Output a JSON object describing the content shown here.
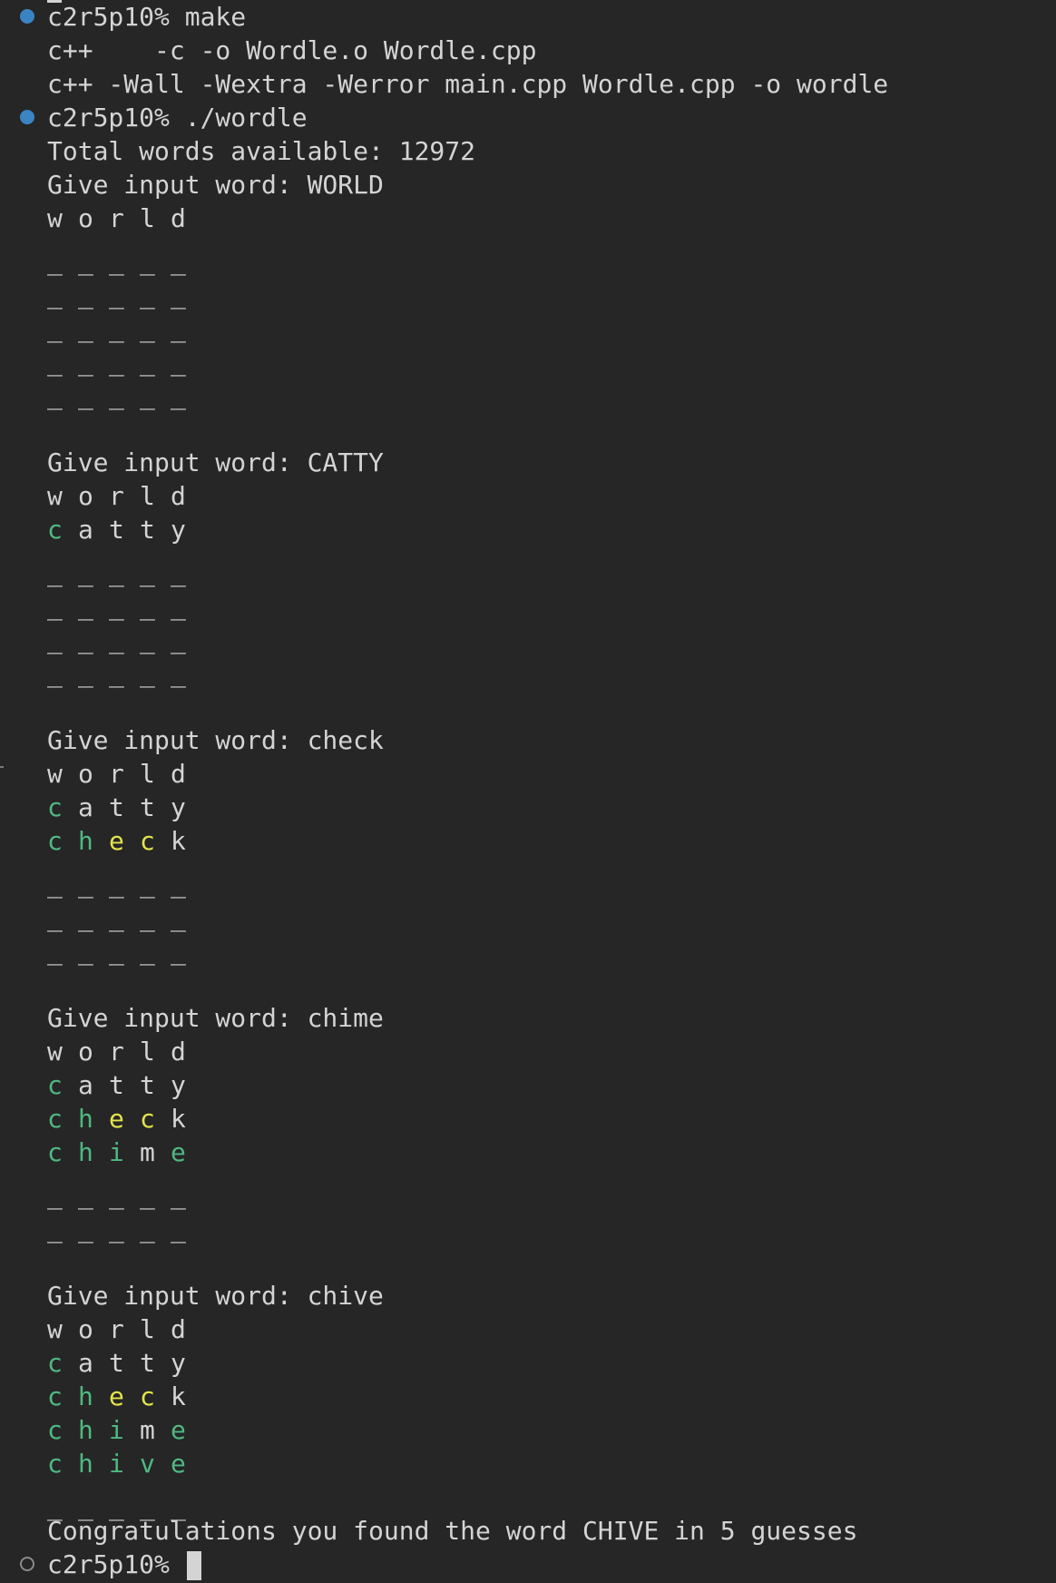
{
  "prompt": "c2r5p10%",
  "commands": {
    "make": "make",
    "run": "./wordle"
  },
  "build_output": [
    "c++    -c -o Wordle.o Wordle.cpp",
    "c++ -Wall -Wextra -Werror main.cpp Wordle.cpp -o wordle"
  ],
  "total_words_line": "Total words available: 12972",
  "input_prompt": "Give input word: ",
  "blank_cell": "_",
  "rounds": [
    {
      "input": "WORLD",
      "rows": [
        [
          {
            "ch": "w",
            "c": "gray"
          },
          {
            "ch": "o",
            "c": "gray"
          },
          {
            "ch": "r",
            "c": "gray"
          },
          {
            "ch": "l",
            "c": "gray"
          },
          {
            "ch": "d",
            "c": "gray"
          }
        ]
      ],
      "blank_rows": 5
    },
    {
      "input": "CATTY",
      "rows": [
        [
          {
            "ch": "w",
            "c": "gray"
          },
          {
            "ch": "o",
            "c": "gray"
          },
          {
            "ch": "r",
            "c": "gray"
          },
          {
            "ch": "l",
            "c": "gray"
          },
          {
            "ch": "d",
            "c": "gray"
          }
        ],
        [
          {
            "ch": "c",
            "c": "green"
          },
          {
            "ch": "a",
            "c": "gray"
          },
          {
            "ch": "t",
            "c": "gray"
          },
          {
            "ch": "t",
            "c": "gray"
          },
          {
            "ch": "y",
            "c": "gray"
          }
        ]
      ],
      "blank_rows": 4
    },
    {
      "input": "check",
      "rows": [
        [
          {
            "ch": "w",
            "c": "gray"
          },
          {
            "ch": "o",
            "c": "gray"
          },
          {
            "ch": "r",
            "c": "gray"
          },
          {
            "ch": "l",
            "c": "gray"
          },
          {
            "ch": "d",
            "c": "gray"
          }
        ],
        [
          {
            "ch": "c",
            "c": "green"
          },
          {
            "ch": "a",
            "c": "gray"
          },
          {
            "ch": "t",
            "c": "gray"
          },
          {
            "ch": "t",
            "c": "gray"
          },
          {
            "ch": "y",
            "c": "gray"
          }
        ],
        [
          {
            "ch": "c",
            "c": "green"
          },
          {
            "ch": "h",
            "c": "green"
          },
          {
            "ch": "e",
            "c": "yellow"
          },
          {
            "ch": "c",
            "c": "yellow"
          },
          {
            "ch": "k",
            "c": "gray"
          }
        ]
      ],
      "blank_rows": 3
    },
    {
      "input": "chime",
      "rows": [
        [
          {
            "ch": "w",
            "c": "gray"
          },
          {
            "ch": "o",
            "c": "gray"
          },
          {
            "ch": "r",
            "c": "gray"
          },
          {
            "ch": "l",
            "c": "gray"
          },
          {
            "ch": "d",
            "c": "gray"
          }
        ],
        [
          {
            "ch": "c",
            "c": "green"
          },
          {
            "ch": "a",
            "c": "gray"
          },
          {
            "ch": "t",
            "c": "gray"
          },
          {
            "ch": "t",
            "c": "gray"
          },
          {
            "ch": "y",
            "c": "gray"
          }
        ],
        [
          {
            "ch": "c",
            "c": "green"
          },
          {
            "ch": "h",
            "c": "green"
          },
          {
            "ch": "e",
            "c": "yellow"
          },
          {
            "ch": "c",
            "c": "yellow"
          },
          {
            "ch": "k",
            "c": "gray"
          }
        ],
        [
          {
            "ch": "c",
            "c": "green"
          },
          {
            "ch": "h",
            "c": "green"
          },
          {
            "ch": "i",
            "c": "green"
          },
          {
            "ch": "m",
            "c": "gray"
          },
          {
            "ch": "e",
            "c": "green"
          }
        ]
      ],
      "blank_rows": 2
    },
    {
      "input": "chive",
      "rows": [
        [
          {
            "ch": "w",
            "c": "gray"
          },
          {
            "ch": "o",
            "c": "gray"
          },
          {
            "ch": "r",
            "c": "gray"
          },
          {
            "ch": "l",
            "c": "gray"
          },
          {
            "ch": "d",
            "c": "gray"
          }
        ],
        [
          {
            "ch": "c",
            "c": "green"
          },
          {
            "ch": "a",
            "c": "gray"
          },
          {
            "ch": "t",
            "c": "gray"
          },
          {
            "ch": "t",
            "c": "gray"
          },
          {
            "ch": "y",
            "c": "gray"
          }
        ],
        [
          {
            "ch": "c",
            "c": "green"
          },
          {
            "ch": "h",
            "c": "green"
          },
          {
            "ch": "e",
            "c": "yellow"
          },
          {
            "ch": "c",
            "c": "yellow"
          },
          {
            "ch": "k",
            "c": "gray"
          }
        ],
        [
          {
            "ch": "c",
            "c": "green"
          },
          {
            "ch": "h",
            "c": "green"
          },
          {
            "ch": "i",
            "c": "green"
          },
          {
            "ch": "m",
            "c": "gray"
          },
          {
            "ch": "e",
            "c": "green"
          }
        ],
        [
          {
            "ch": "c",
            "c": "green"
          },
          {
            "ch": "h",
            "c": "green"
          },
          {
            "ch": "i",
            "c": "green"
          },
          {
            "ch": "v",
            "c": "green"
          },
          {
            "ch": "e",
            "c": "green"
          }
        ]
      ],
      "blank_rows": 1
    }
  ],
  "congrats": "Congratulations you found the word CHIVE in 5 guesses",
  "colors": {
    "background": "#262626",
    "text": "#d4d4d4",
    "green": "#4fb882",
    "yellow": "#e3e34e",
    "dot_blue": "#3b84c4"
  }
}
